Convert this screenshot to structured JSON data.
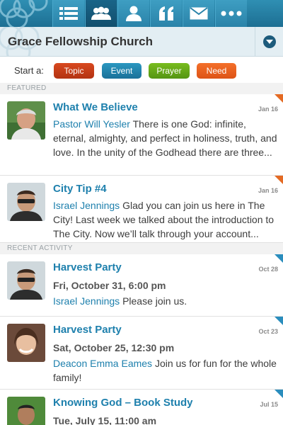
{
  "nav": {
    "tabs": [
      {
        "name": "tab-list",
        "icon": "list-icon"
      },
      {
        "name": "tab-people",
        "icon": "people-icon",
        "active": true
      },
      {
        "name": "tab-person",
        "icon": "person-icon"
      },
      {
        "name": "tab-quote",
        "icon": "quote-icon"
      },
      {
        "name": "tab-mail",
        "icon": "mail-icon"
      },
      {
        "name": "tab-more",
        "icon": "more-icon"
      }
    ],
    "brand_icon": "city-logo-icon"
  },
  "church": {
    "name": "Grace Fellowship Church",
    "menu_icon": "chevron-down-icon"
  },
  "start": {
    "label": "Start a:",
    "buttons": {
      "topic": "Topic",
      "event": "Event",
      "prayer": "Prayer",
      "need": "Need"
    }
  },
  "sections": {
    "featured": "FEATURED",
    "recent": "RECENT ACTIVITY"
  },
  "featured": [
    {
      "title": "What We Believe",
      "date": "Jan 16",
      "author": "Pastor Will Yesler",
      "text": "There is one God: infinite, eternal, almighty, and perfect in holiness, truth, and love. In the unity of the Godhead there are three...",
      "corner": "orange"
    },
    {
      "title": "City Tip #4",
      "date": "Jan 16",
      "author": "Israel Jennings",
      "text": "Glad you can join us here in The City! Last week we talked about the introduction to The City. Now we’ll talk through your account...",
      "corner": "orange"
    }
  ],
  "recent": [
    {
      "title": "Harvest Party",
      "date": "Oct 28",
      "when": "Fri, October 31, 6:00 pm",
      "author": "Israel Jennings",
      "text": "Please join us.",
      "corner": "blue"
    },
    {
      "title": "Harvest Party",
      "date": "Oct 23",
      "when": "Sat, October 25, 12:30 pm",
      "author": "Deacon Emma Eames",
      "text": "Join us for fun for the whole family!",
      "corner": "blue"
    },
    {
      "title": "Knowing God – Book Study",
      "date": "Jul 15",
      "when": "Tue, July 15, 11:00 am",
      "author": "",
      "text": "",
      "corner": "blue"
    }
  ]
}
